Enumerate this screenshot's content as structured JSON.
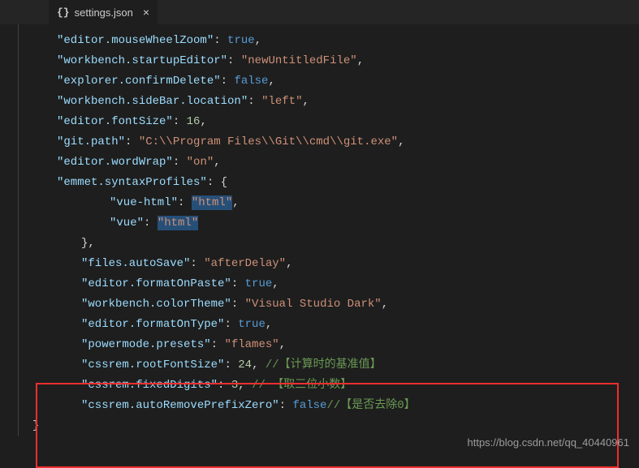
{
  "tab": {
    "icon": "{}",
    "filename": "settings.json"
  },
  "lines": [
    {
      "indent": 1,
      "tokens": [
        [
          "key",
          "\"editor.mouseWheelZoom\""
        ],
        [
          "punc",
          ": "
        ],
        [
          "bool",
          "true"
        ],
        [
          "punc",
          ","
        ]
      ]
    },
    {
      "indent": 1,
      "tokens": [
        [
          "key",
          "\"workbench.startupEditor\""
        ],
        [
          "punc",
          ": "
        ],
        [
          "str",
          "\"newUntitledFile\""
        ],
        [
          "punc",
          ","
        ]
      ]
    },
    {
      "indent": 1,
      "tokens": [
        [
          "key",
          "\"explorer.confirmDelete\""
        ],
        [
          "punc",
          ": "
        ],
        [
          "bool",
          "false"
        ],
        [
          "punc",
          ","
        ]
      ]
    },
    {
      "indent": 1,
      "tokens": [
        [
          "key",
          "\"workbench.sideBar.location\""
        ],
        [
          "punc",
          ": "
        ],
        [
          "str",
          "\"left\""
        ],
        [
          "punc",
          ","
        ]
      ]
    },
    {
      "indent": 1,
      "tokens": [
        [
          "key",
          "\"editor.fontSize\""
        ],
        [
          "punc",
          ": "
        ],
        [
          "num",
          "16"
        ],
        [
          "punc",
          ","
        ]
      ]
    },
    {
      "indent": 1,
      "tokens": [
        [
          "key",
          "\"git.path\""
        ],
        [
          "punc",
          ": "
        ],
        [
          "str",
          "\"C:\\\\Program Files\\\\Git\\\\cmd\\\\git.exe\""
        ],
        [
          "punc",
          ","
        ]
      ]
    },
    {
      "indent": 1,
      "tokens": [
        [
          "key",
          "\"editor.wordWrap\""
        ],
        [
          "punc",
          ": "
        ],
        [
          "str",
          "\"on\""
        ],
        [
          "punc",
          ","
        ]
      ]
    },
    {
      "indent": 1,
      "tokens": [
        [
          "key",
          "\"emmet.syntaxProfiles\""
        ],
        [
          "punc",
          ": {"
        ]
      ]
    },
    {
      "indent": 3,
      "tokens": [
        [
          "key",
          "\"vue-html\""
        ],
        [
          "punc",
          ": "
        ],
        [
          "str-hl",
          "\"html\""
        ],
        [
          "punc",
          ","
        ]
      ]
    },
    {
      "indent": 3,
      "tokens": [
        [
          "key",
          "\"vue\""
        ],
        [
          "punc",
          ": "
        ],
        [
          "str-hl",
          "\"html\""
        ]
      ]
    },
    {
      "indent": 2,
      "tokens": [
        [
          "punc",
          "},"
        ]
      ]
    },
    {
      "indent": 2,
      "tokens": [
        [
          "key",
          "\"files.autoSave\""
        ],
        [
          "punc",
          ": "
        ],
        [
          "str",
          "\"afterDelay\""
        ],
        [
          "punc",
          ","
        ]
      ]
    },
    {
      "indent": 2,
      "tokens": [
        [
          "key",
          "\"editor.formatOnPaste\""
        ],
        [
          "punc",
          ": "
        ],
        [
          "bool",
          "true"
        ],
        [
          "punc",
          ","
        ]
      ]
    },
    {
      "indent": 2,
      "tokens": [
        [
          "key",
          "\"workbench.colorTheme\""
        ],
        [
          "punc",
          ": "
        ],
        [
          "str",
          "\"Visual Studio Dark\""
        ],
        [
          "punc",
          ","
        ]
      ]
    },
    {
      "indent": 2,
      "tokens": [
        [
          "key",
          "\"editor.formatOnType\""
        ],
        [
          "punc",
          ": "
        ],
        [
          "bool",
          "true"
        ],
        [
          "punc",
          ","
        ]
      ]
    },
    {
      "indent": 2,
      "tokens": [
        [
          "key",
          "\"powermode.presets\""
        ],
        [
          "punc",
          ": "
        ],
        [
          "str",
          "\"flames\""
        ],
        [
          "punc",
          ","
        ]
      ]
    },
    {
      "indent": 2,
      "tokens": [
        [
          "key",
          "\"cssrem.rootFontSize\""
        ],
        [
          "punc",
          ": "
        ],
        [
          "num",
          "24"
        ],
        [
          "punc",
          ", "
        ],
        [
          "comment",
          "//【计算时的基准值】"
        ]
      ]
    },
    {
      "indent": 2,
      "tokens": [
        [
          "key",
          "\"cssrem.fixedDigits\""
        ],
        [
          "punc",
          ": "
        ],
        [
          "num",
          "3"
        ],
        [
          "punc",
          ", "
        ],
        [
          "comment",
          "// 【取三位小数】"
        ]
      ]
    },
    {
      "indent": 2,
      "tokens": [
        [
          "key",
          "\"cssrem.autoRemovePrefixZero\""
        ],
        [
          "punc",
          ": "
        ],
        [
          "bool",
          "false"
        ],
        [
          "comment",
          "//【是否去除0】"
        ]
      ]
    },
    {
      "indent": 0,
      "tokens": [
        [
          "punc",
          "}"
        ]
      ]
    }
  ],
  "watermark": "https://blog.csdn.net/qq_40440961"
}
